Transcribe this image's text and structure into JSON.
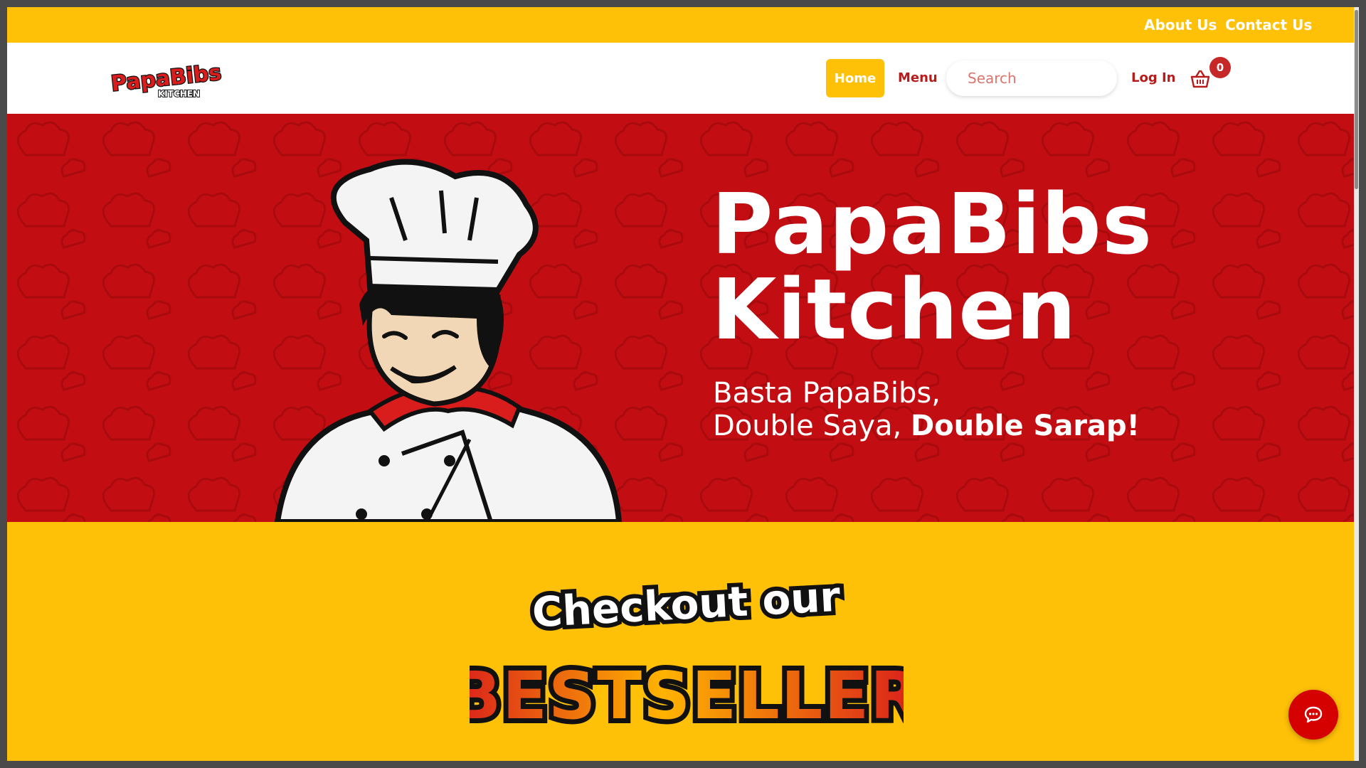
{
  "topbar": {
    "about_label": "About Us",
    "contact_label": "Contact Us"
  },
  "navbar": {
    "logo_text": "PapaBibs",
    "logo_subtext": "KITCHEN",
    "home_label": "Home",
    "menu_label": "Menu",
    "search_placeholder": "Search",
    "login_label": "Log In",
    "cart_count": "0"
  },
  "hero": {
    "title_line1": "PapaBibs",
    "title_line2": "Kitchen",
    "subtitle_line1": "Basta PapaBibs,",
    "subtitle_line2_regular": "Double Saya, ",
    "subtitle_line2_bold": "Double Sarap!"
  },
  "bestseller": {
    "line1": "Checkout our",
    "line2": "BESTSELLER"
  },
  "icons": {
    "cart": "shopping-basket-icon",
    "chat": "chat-bubble-icon"
  },
  "colors": {
    "yellow": "#FFC107",
    "red": "#C20E12",
    "dark_red": "#B71C1C",
    "white": "#FFFFFF"
  }
}
